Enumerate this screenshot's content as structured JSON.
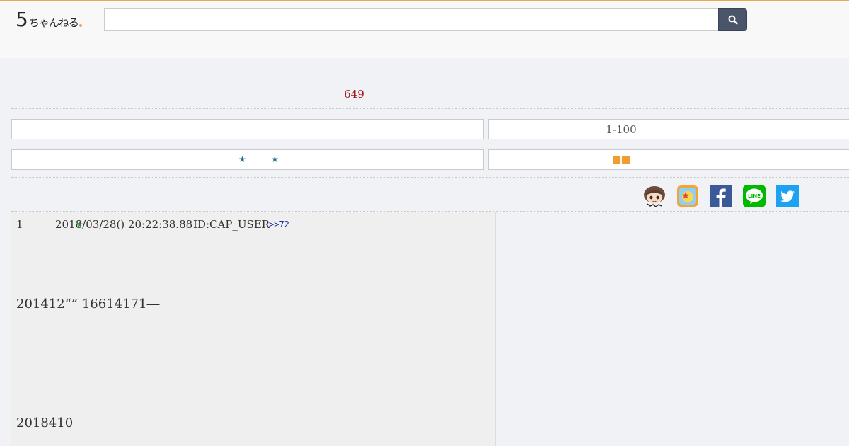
{
  "header": {
    "logo_number": "5",
    "logo_text": "ちゃんねる",
    "search": {
      "value": "",
      "placeholder": ""
    }
  },
  "thread": {
    "count": "649",
    "nav_range": "1-100"
  },
  "share": [
    {
      "name": "mascot-icon"
    },
    {
      "name": "app-icon"
    },
    {
      "name": "facebook-icon",
      "label": "f"
    },
    {
      "name": "line-icon",
      "label": "LINE"
    },
    {
      "name": "twitter-icon"
    }
  ],
  "post": {
    "number": "1",
    "date": "2018/03/28() 20:22:38.88",
    "id": "ID:CAP_USER",
    "reply": ">>72",
    "body_line1": "201412“” 16614171―",
    "body_line2": "2018410"
  },
  "colors": {
    "accent": "#f0a64a",
    "count": "#a3161b",
    "search_button": "#4b5569",
    "facebook": "#3b5998",
    "line": "#00b900",
    "twitter": "#1da1f2"
  }
}
